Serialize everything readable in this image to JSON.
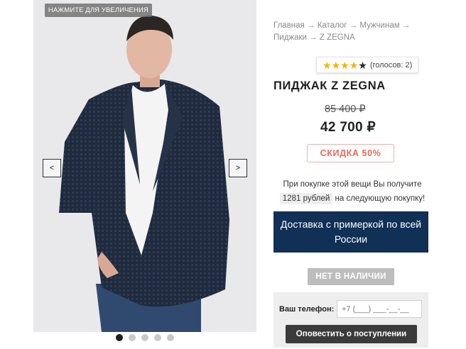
{
  "gallery": {
    "zoom_hint": "НАЖМИТЕ ДЛЯ УВЕЛИЧЕНИЯ",
    "prev_label": "<",
    "next_label": ">",
    "dots_total": 5,
    "active_dot": 1
  },
  "breadcrumb": {
    "items": [
      "Главная",
      "Каталог",
      "Мужчинам",
      "Пиджаки",
      "Z ZEGNA"
    ],
    "separator": "→"
  },
  "rating": {
    "stars_filled": 4,
    "stars_total": 5,
    "votes": "(голосов: 2)"
  },
  "product": {
    "title": "ПИДЖАК Z ZEGNA",
    "old_price": "85 400 ₽",
    "price": "42 700 ₽",
    "discount": "СКИДКА 50%"
  },
  "bonus": {
    "line1": "При покупке этой вещи Вы получите",
    "amount": "1281 рублей",
    "line2": "на следующую покупку!"
  },
  "delivery": {
    "label": "Доставка с примеркой по всей России"
  },
  "stock": {
    "label": "НЕТ В НАЛИЧИИ"
  },
  "notify": {
    "phone_label": "Ваш телефон:",
    "phone_placeholder": "+7 (___) ___-__-__",
    "button_label": "Оповестить о поступлении"
  },
  "colors": {
    "delivery_bg": "#103056",
    "discount_text": "#e86b5e",
    "star_on": "#f4b400"
  }
}
